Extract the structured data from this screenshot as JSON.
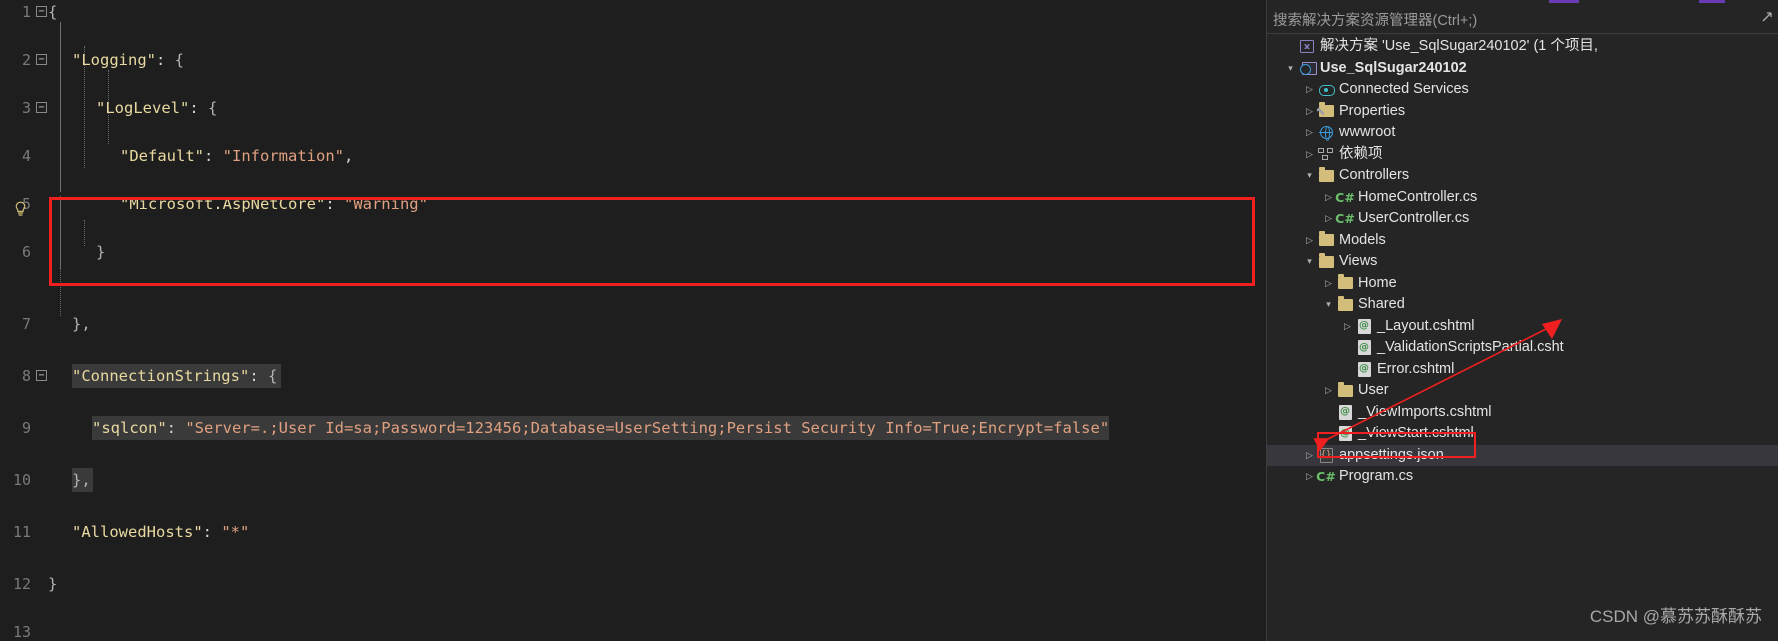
{
  "editor": {
    "lines": [
      {
        "num": "1",
        "fold": "minus",
        "indentGuides": [],
        "text": "{",
        "tokens": [
          {
            "t": "{",
            "c": "tok-brace"
          }
        ]
      },
      {
        "num": "2",
        "fold": "minus",
        "text": "  \"Logging\": {"
      },
      {
        "num": "3",
        "fold": "minus",
        "text": "    \"LogLevel\": {"
      },
      {
        "num": "4",
        "fold": "none",
        "text": "      \"Default\": \"Information\","
      },
      {
        "num": "5",
        "fold": "none",
        "text": "      \"Microsoft.AspNetCore\": \"Warning\""
      },
      {
        "num": "6",
        "fold": "none",
        "text": "    }"
      },
      {
        "num": "7",
        "fold": "none",
        "text": "  },"
      },
      {
        "num": "8",
        "fold": "minus",
        "text": "  \"ConnectionStrings\": {"
      },
      {
        "num": "9",
        "fold": "none",
        "text": "    \"sqlcon\": \"Server=.;User Id=sa;Password=123456;Database=UserSetting;Persist Security Info=True;Encrypt=false\""
      },
      {
        "num": "10",
        "fold": "none",
        "text": "  },"
      },
      {
        "num": "11",
        "fold": "none",
        "text": "  \"AllowedHosts\": \"*\""
      },
      {
        "num": "12",
        "fold": "none",
        "text": "}"
      },
      {
        "num": "13",
        "fold": "none",
        "text": ""
      }
    ],
    "line1": {
      "brace": "{"
    },
    "line2": {
      "key": "\"Logging\"",
      "colon": ": ",
      "brace": "{"
    },
    "line3": {
      "key": "\"LogLevel\"",
      "colon": ": ",
      "brace": "{"
    },
    "line4": {
      "key": "\"Default\"",
      "colon": ": ",
      "value": "\"Information\"",
      "comma": ","
    },
    "line5": {
      "key": "\"Microsoft.AspNetCore\"",
      "colon": ": ",
      "value": "\"Warning\""
    },
    "line6": {
      "brace": "}"
    },
    "line7": {
      "brace": "},"
    },
    "line8": {
      "key": "\"ConnectionStrings\"",
      "colon": ": ",
      "brace": "{"
    },
    "line9": {
      "key": "\"sqlcon\"",
      "colon": ": ",
      "value": "\"Server=.;User Id=sa;Password=123456;Database=UserSetting;Persist Security Info=True;Encrypt=false\""
    },
    "line10": {
      "brace": "},"
    },
    "line11": {
      "key": "\"AllowedHosts\"",
      "colon": ": ",
      "value": "\"*\""
    },
    "line12": {
      "brace": "}"
    },
    "bulb_glyph": " ",
    "fold_glyph": "−",
    "line_numbers": [
      "1",
      "2",
      "3",
      "4",
      "5",
      "6",
      "7",
      "8",
      "9",
      "10",
      "11",
      "12",
      "13"
    ],
    "colors": {
      "key": "#e8d9a0",
      "string": "#e0a080",
      "punct": "#d4d4d4",
      "background": "#1e1e1e",
      "highlight": "#3a3a3a",
      "annotation_red": "#f02020"
    }
  },
  "explorer": {
    "search": {
      "placeholder": "搜索解决方案资源管理器(Ctrl+;)",
      "icons": [
        "search-icon",
        "filter-icon"
      ]
    },
    "solution_row": {
      "label": "解决方案 'Use_SqlSugar240102' (1 个项目,",
      "icon": "solution-icon"
    },
    "tree": [
      {
        "id": "project",
        "label": "Use_SqlSugar240102",
        "indent": 1,
        "chev": "open",
        "icon": "project-web-icon",
        "bold": true,
        "selected": false
      },
      {
        "id": "connected-services",
        "label": "Connected Services",
        "indent": 2,
        "chev": "closed",
        "icon": "connected-services-icon",
        "bold": false,
        "selected": false
      },
      {
        "id": "properties",
        "label": "Properties",
        "indent": 2,
        "chev": "closed",
        "icon": "properties-folder-icon",
        "bold": false,
        "selected": false
      },
      {
        "id": "wwwroot",
        "label": "wwwroot",
        "indent": 2,
        "chev": "closed",
        "icon": "globe-icon",
        "bold": false,
        "selected": false
      },
      {
        "id": "dependencies",
        "label": "依赖项",
        "indent": 2,
        "chev": "closed",
        "icon": "dependencies-icon",
        "bold": false,
        "selected": false
      },
      {
        "id": "controllers",
        "label": "Controllers",
        "indent": 2,
        "chev": "open",
        "icon": "folder-icon",
        "bold": false,
        "selected": false
      },
      {
        "id": "home-controller",
        "label": "HomeController.cs",
        "indent": 3,
        "chev": "closed",
        "icon": "csharp-icon",
        "bold": false,
        "selected": false
      },
      {
        "id": "user-controller",
        "label": "UserController.cs",
        "indent": 3,
        "chev": "closed",
        "icon": "csharp-icon",
        "bold": false,
        "selected": false
      },
      {
        "id": "models",
        "label": "Models",
        "indent": 2,
        "chev": "closed",
        "icon": "folder-icon",
        "bold": false,
        "selected": false
      },
      {
        "id": "views",
        "label": "Views",
        "indent": 2,
        "chev": "open",
        "icon": "folder-icon",
        "bold": false,
        "selected": false
      },
      {
        "id": "views-home",
        "label": "Home",
        "indent": 3,
        "chev": "closed",
        "icon": "folder-icon",
        "bold": false,
        "selected": false
      },
      {
        "id": "views-shared",
        "label": "Shared",
        "indent": 3,
        "chev": "open",
        "icon": "folder-icon",
        "bold": false,
        "selected": false
      },
      {
        "id": "layout-cshtml",
        "label": "_Layout.cshtml",
        "indent": 4,
        "chev": "closed",
        "icon": "razor-icon",
        "bold": false,
        "selected": false
      },
      {
        "id": "validation-scripts",
        "label": "_ValidationScriptsPartial.csht",
        "indent": 4,
        "chev": "none",
        "icon": "razor-icon",
        "bold": false,
        "selected": false
      },
      {
        "id": "error-cshtml",
        "label": "Error.cshtml",
        "indent": 4,
        "chev": "none",
        "icon": "razor-icon",
        "bold": false,
        "selected": false
      },
      {
        "id": "views-user",
        "label": "User",
        "indent": 3,
        "chev": "closed",
        "icon": "folder-icon",
        "bold": false,
        "selected": false
      },
      {
        "id": "viewimports-cshtml",
        "label": "_ViewImports.cshtml",
        "indent": 3,
        "chev": "none",
        "icon": "razor-icon",
        "bold": false,
        "selected": false
      },
      {
        "id": "viewstart-cshtml",
        "label": "_ViewStart.cshtml",
        "indent": 3,
        "chev": "none",
        "icon": "razor-icon",
        "bold": false,
        "selected": false
      },
      {
        "id": "appsettings-json",
        "label": "appsettings.json",
        "indent": 2,
        "chev": "closed",
        "icon": "json-icon",
        "bold": false,
        "selected": true
      },
      {
        "id": "program-cs",
        "label": "Program.cs",
        "indent": 2,
        "chev": "closed",
        "icon": "csharp-icon",
        "bold": false,
        "selected": false
      }
    ]
  },
  "watermark": {
    "text": "CSDN @慕苏苏酥酥苏"
  },
  "annotations": {
    "arrow_color": "#f02020",
    "code_box_label": "connection-strings-highlight",
    "file_box_label": "appsettings-json-highlight"
  }
}
